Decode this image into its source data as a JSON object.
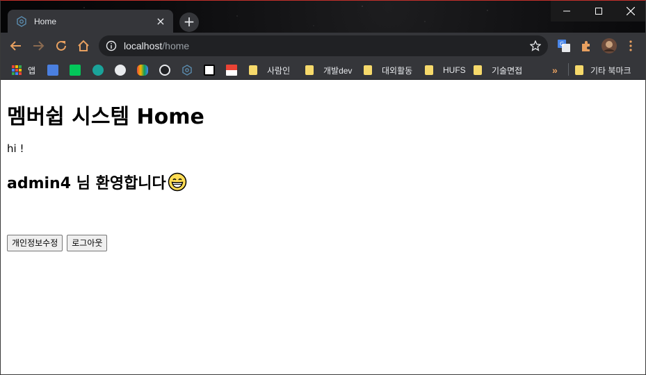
{
  "browser": {
    "tab": {
      "title": "Home",
      "favicon": "react-like-icon"
    },
    "new_tab_icon": "plus-icon",
    "window_controls": [
      "minimize-icon",
      "maximize-icon",
      "close-icon"
    ],
    "address": {
      "host": "localhost",
      "path": "/home"
    },
    "nav": [
      "back-icon",
      "forward-icon",
      "reload-icon",
      "home-icon"
    ],
    "extensions": [
      "google-translate-icon",
      "puzzle-icon",
      "profile-avatar"
    ],
    "bookmarks": [
      {
        "label": "앱",
        "icon": "apps-grid-icon"
      },
      {
        "label": "",
        "icon": "saramin-icon"
      },
      {
        "label": "",
        "icon": "naver-icon"
      },
      {
        "label": "",
        "icon": "edge-icon"
      },
      {
        "label": "",
        "icon": "robot-icon"
      },
      {
        "label": "",
        "icon": "hand-icon"
      },
      {
        "label": "",
        "icon": "github-icon"
      },
      {
        "label": "",
        "icon": "react-icon"
      },
      {
        "label": "",
        "icon": "notion-icon"
      },
      {
        "label": "",
        "icon": "gmail-icon"
      },
      {
        "label": "사람인",
        "icon": "folder-icon"
      },
      {
        "label": "개발dev",
        "icon": "folder-icon"
      },
      {
        "label": "대외활동",
        "icon": "folder-icon"
      },
      {
        "label": "HUFS",
        "icon": "folder-icon"
      },
      {
        "label": "기술면접",
        "icon": "folder-icon"
      }
    ],
    "overflow_label": "»",
    "other_bookmarks": "기타 북마크"
  },
  "page": {
    "title": "멤버쉽 시스템 Home",
    "greeting": "hi !",
    "welcome": "admin4 님 환영합니다",
    "welcome_icon": "grinning-emoji",
    "buttons": {
      "edit": "개인정보수정",
      "logout": "로그아웃"
    }
  },
  "colors": {
    "chrome_dark": "#35363a",
    "omnibox": "#202124",
    "nav_icon_orange": "#e8a060",
    "folder": "#f6d96b"
  }
}
